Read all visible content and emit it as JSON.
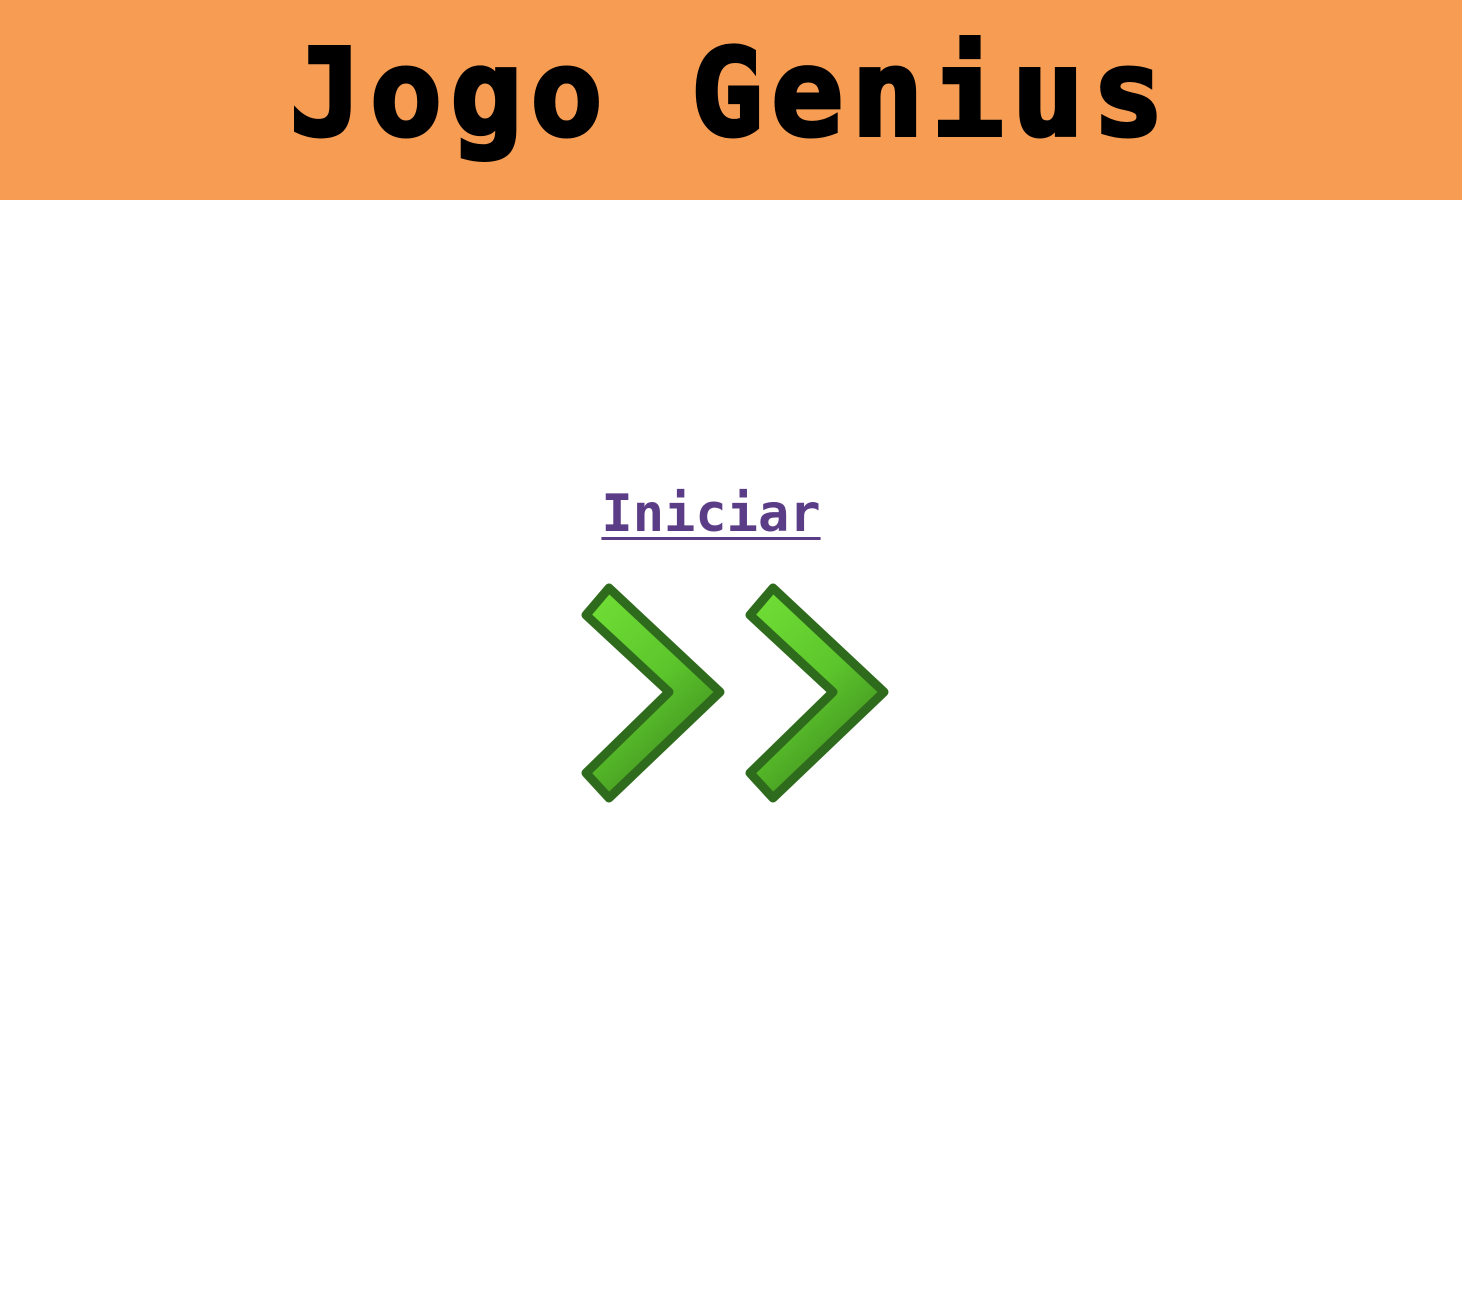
{
  "header": {
    "title": "Jogo Genius",
    "background_color": "#f79d53"
  },
  "main": {
    "start_label": "Iniciar",
    "start_link_color": "#5b3c86",
    "start_icon": "double-chevron-right-icon",
    "icon_colors": {
      "fill_light": "#72e136",
      "fill_dark": "#3f8c1e",
      "stroke": "#2f6b1c"
    }
  }
}
